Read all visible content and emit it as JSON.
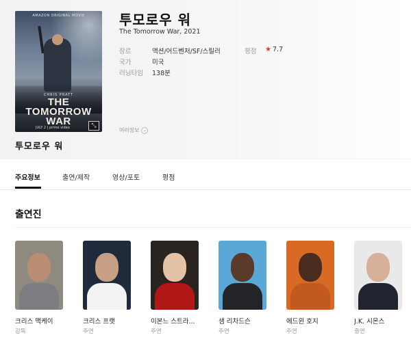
{
  "movie": {
    "title_ko": "투모로우 워",
    "title_en_year": "The Tomorrow War, 2021",
    "poster": {
      "studio_text": "AMAZON ORIGINAL MOVIE",
      "actor_text": "CHRIS PRATT",
      "title_art": "THE TOMORROW WAR",
      "date_text": "JULY 2 | prime video",
      "expand_icon": "expand-icon"
    },
    "meta": {
      "genre_label": "장르",
      "genre_value": "액션/어드벤처/SF/스릴러",
      "rating_label": "평점",
      "rating_star": "★",
      "rating_value": "7.7",
      "country_label": "국가",
      "country_value": "미국",
      "runtime_label": "러닝타임",
      "runtime_value": "138분"
    },
    "more_info": "여러정보"
  },
  "section_title": "투모로우 워",
  "tabs": [
    {
      "label": "주요정보",
      "active": true
    },
    {
      "label": "출연/제작",
      "active": false
    },
    {
      "label": "영상/포토",
      "active": false
    },
    {
      "label": "평점",
      "active": false
    }
  ],
  "cast_section": {
    "title": "출연진",
    "members": [
      {
        "name": "크리스 맥케이",
        "role": "감독",
        "skin": "#b98c74",
        "shirt": "#7b7d80",
        "bg": "#8e8a80"
      },
      {
        "name": "크리스 프랫",
        "role": "주연",
        "skin": "#c79f85",
        "shirt": "#f2f2f2",
        "bg": "#1f2b3a"
      },
      {
        "name": "이본느 스트라...",
        "role": "주연",
        "skin": "#e4c2a6",
        "shirt": "#b01818",
        "bg": "#2a2420"
      },
      {
        "name": "샘 리차드슨",
        "role": "주연",
        "skin": "#5b3a2a",
        "shirt": "#222428",
        "bg": "#5aa8d6"
      },
      {
        "name": "에드윈 호지",
        "role": "주연",
        "skin": "#4a2c1e",
        "shirt": "#c25a20",
        "bg": "#d86a24"
      },
      {
        "name": "J.K. 시몬스",
        "role": "출연",
        "skin": "#d6b09a",
        "shirt": "#1f2430",
        "bg": "#e9e9ea"
      }
    ]
  }
}
